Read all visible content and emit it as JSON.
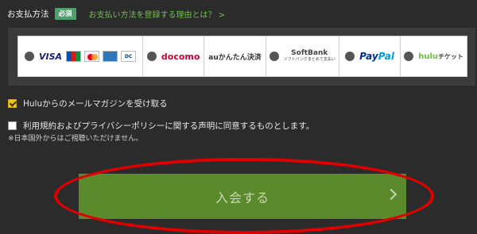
{
  "header": {
    "title": "お支払方法",
    "required_badge": "必須",
    "reason_link": "お支払い方法を登録する理由とは？ >"
  },
  "payment_methods": [
    {
      "name": "credit-card",
      "labels": [
        "VISA",
        "JCB",
        "MasterCard",
        "AMEX",
        "Diners Club"
      ]
    },
    {
      "name": "docomo",
      "label": "docomo"
    },
    {
      "name": "au",
      "label": "auかんたん決済"
    },
    {
      "name": "softbank",
      "label": "SoftBank",
      "sub": "ソフトバンクまとめて支払い"
    },
    {
      "name": "paypal",
      "label_a": "Pay",
      "label_b": "Pal"
    },
    {
      "name": "hulu-ticket",
      "label_a": "hulu",
      "label_b": "チケット"
    }
  ],
  "newsletter": {
    "label": "Huluからのメールマガジンを受け取る",
    "checked": true
  },
  "terms": {
    "label": "利用規約およびプライバシーポリシーに関する声明に同意するものとします。",
    "checked": false
  },
  "note": "※日本国外からはご視聴いただけません。",
  "join_button": {
    "label": "入会する"
  }
}
